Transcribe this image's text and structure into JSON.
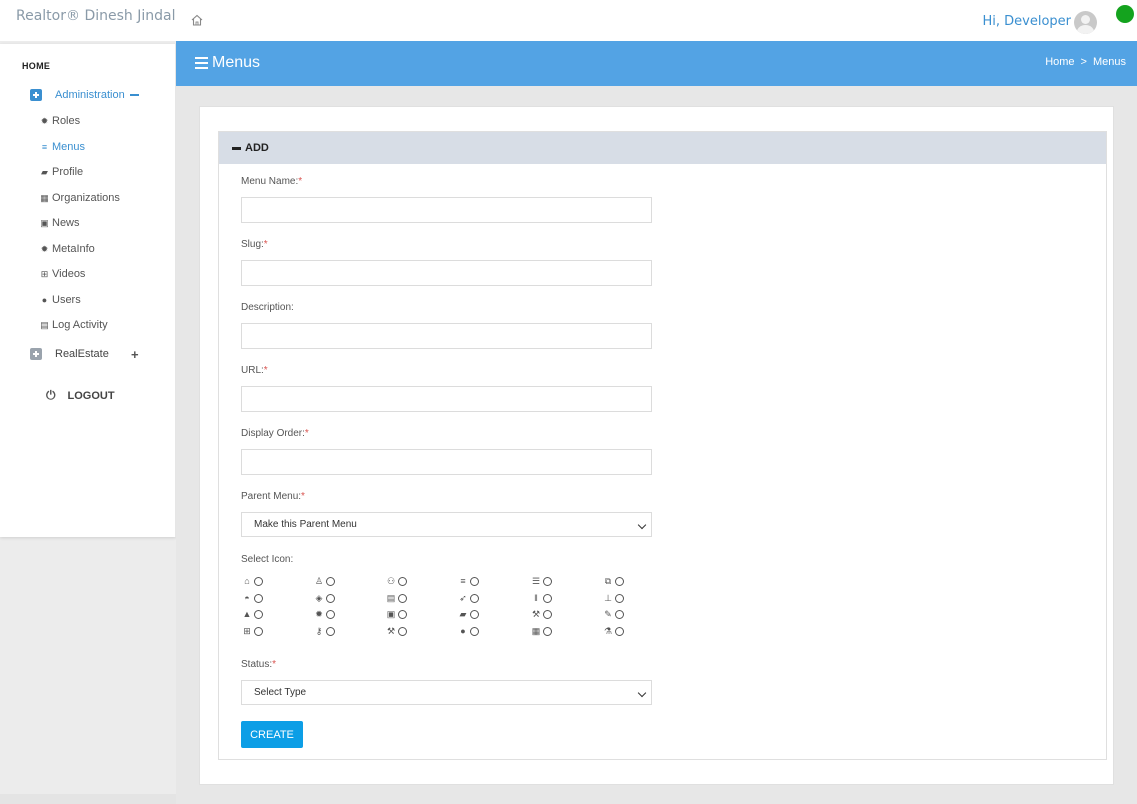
{
  "app": {
    "brand": "Realtor® Dinesh Jindal",
    "greeting": "Hi, Developer"
  },
  "sidebar": {
    "home": "HOME",
    "admin": {
      "label": "Administration",
      "icon": "plus-square-icon",
      "color": "#3a8fd0"
    },
    "items": [
      {
        "label": "Roles",
        "icon": "cog-icon",
        "glyph": "✹"
      },
      {
        "label": "Menus",
        "icon": "bars-icon",
        "glyph": "≡"
      },
      {
        "label": "Profile",
        "icon": "book-icon",
        "glyph": "▰"
      },
      {
        "label": "Organizations",
        "icon": "building-icon",
        "glyph": "▦"
      },
      {
        "label": "News",
        "icon": "image-icon",
        "glyph": "▣"
      },
      {
        "label": "MetaInfo",
        "icon": "cog-icon",
        "glyph": "✹"
      },
      {
        "label": "Videos",
        "icon": "plus-square-icon",
        "glyph": "⊞"
      },
      {
        "label": "Users",
        "icon": "check-circle-icon",
        "glyph": "●"
      },
      {
        "label": "Log Activity",
        "icon": "file-icon",
        "glyph": "▤"
      }
    ],
    "realestate": "RealEstate",
    "logout": "LOGOUT"
  },
  "header": {
    "title": "Menus",
    "breadcrumb_home": "Home",
    "breadcrumb_sep": ">",
    "breadcrumb_current": "Menus"
  },
  "form": {
    "panel_title": "ADD",
    "menu_name_label": "Menu Name:",
    "slug_label": "Slug:",
    "description_label": "Description:",
    "url_label": "URL:",
    "display_order_label": "Display Order:",
    "parent_menu_label": "Parent Menu:",
    "parent_menu_value": "Make this Parent Menu",
    "select_icon_label": "Select Icon:",
    "status_label": "Status:",
    "status_value": "Select Type",
    "required_mark": "*",
    "create_button": "CREATE"
  },
  "icons": [
    {
      "name": "home-icon",
      "glyph": "⌂"
    },
    {
      "name": "user-icon",
      "glyph": "♙"
    },
    {
      "name": "users-icon",
      "glyph": "⚇"
    },
    {
      "name": "bars-icon",
      "glyph": "≡"
    },
    {
      "name": "list-icon",
      "glyph": "☰"
    },
    {
      "name": "clone-icon",
      "glyph": "⧉"
    },
    {
      "name": "dashboard-icon",
      "glyph": "◓"
    },
    {
      "name": "tags-icon",
      "glyph": "◈"
    },
    {
      "name": "file-icon",
      "glyph": "▤"
    },
    {
      "name": "rocket-icon",
      "glyph": "➶"
    },
    {
      "name": "columns-icon",
      "glyph": "‖"
    },
    {
      "name": "sitemap-icon",
      "glyph": "⊥"
    },
    {
      "name": "road-icon",
      "glyph": "▲"
    },
    {
      "name": "cog-icon",
      "glyph": "✹"
    },
    {
      "name": "image-icon",
      "glyph": "▣"
    },
    {
      "name": "book-icon",
      "glyph": "▰"
    },
    {
      "name": "gavel-icon",
      "glyph": "⚒"
    },
    {
      "name": "pencil-icon",
      "glyph": "✎"
    },
    {
      "name": "plus-square-icon",
      "glyph": "⊞"
    },
    {
      "name": "key-icon",
      "glyph": "⚷"
    },
    {
      "name": "wrench-icon",
      "glyph": "⚒"
    },
    {
      "name": "check-circle-icon",
      "glyph": "●"
    },
    {
      "name": "building-icon",
      "glyph": "▦"
    },
    {
      "name": "flask-icon",
      "glyph": "⚗"
    }
  ],
  "colors": {
    "accent": "#53a3e4",
    "button": "#0c9ee6",
    "status_online": "#14a31e",
    "panel_header": "#d7dde6"
  }
}
